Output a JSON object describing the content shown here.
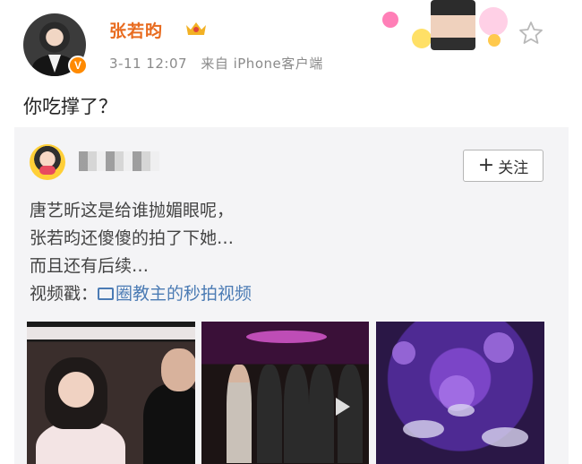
{
  "post": {
    "author": "张若昀",
    "time": "3-11 12:07",
    "source": "来自 iPhone客户端",
    "text": "你吃撑了？"
  },
  "icons": {
    "verified_badge": "v-badge-icon",
    "vip": "crown-icon",
    "favorite": "star-icon",
    "video": "video-icon",
    "play": "play-icon"
  },
  "repost": {
    "follow_label": "关注",
    "follow_plus": "+",
    "lines": [
      "唐艺昕这是给谁抛媚眼呢，",
      "张若昀还傻傻的拍了下她…",
      "而且还有后续…"
    ],
    "video_prefix": "视频戳：",
    "video_link": "圈教主的秒拍视频"
  },
  "colors": {
    "author": "#e86b1f",
    "meta": "#8a8a8a",
    "link": "#4b7bb4",
    "repost_bg": "#f4f4f6"
  }
}
